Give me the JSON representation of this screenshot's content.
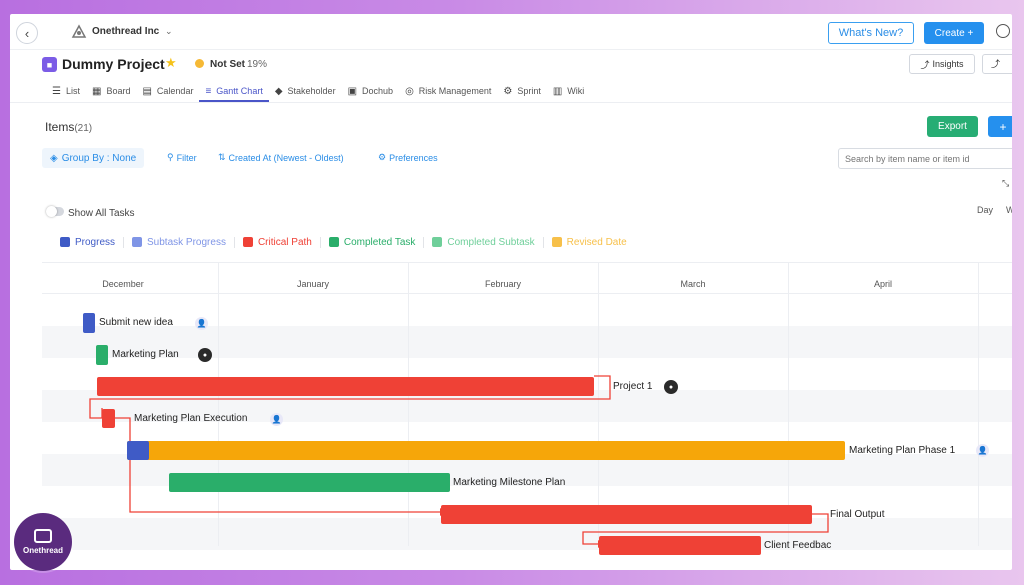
{
  "topbar": {
    "org_name": "Onethread Inc",
    "whats_new": "What's New?",
    "create": "Create +"
  },
  "project": {
    "title": "Dummy Project",
    "status": "Not Set",
    "progress": "19%",
    "insights": "Insights"
  },
  "tabs": [
    {
      "label": "List",
      "icon": "list-icon"
    },
    {
      "label": "Board",
      "icon": "board-icon"
    },
    {
      "label": "Calendar",
      "icon": "calendar-icon"
    },
    {
      "label": "Gantt Chart",
      "icon": "gantt-icon",
      "active": true
    },
    {
      "label": "Stakeholder",
      "icon": "stakeholder-icon"
    },
    {
      "label": "Dochub",
      "icon": "dochub-icon"
    },
    {
      "label": "Risk Management",
      "icon": "risk-icon"
    },
    {
      "label": "Sprint",
      "icon": "sprint-icon"
    },
    {
      "label": "Wiki",
      "icon": "wiki-icon"
    }
  ],
  "items": {
    "label": "Items",
    "count": "(21)",
    "export": "Export",
    "add": "+"
  },
  "toolbar": {
    "group_by": "Group By : None",
    "filter": "Filter",
    "sort": "Created At (Newest - Oldest)",
    "preferences": "Preferences",
    "search_placeholder": "Search by item name or item id"
  },
  "view": {
    "show_all": "Show All Tasks",
    "day": "Day",
    "week": "W"
  },
  "legend": [
    {
      "label": "Progress",
      "color": "#3f5bc6",
      "text_color": "#3f5bc6"
    },
    {
      "label": "Subtask Progress",
      "color": "#7f95e6",
      "text_color": "#7f95e6"
    },
    {
      "label": "Critical Path",
      "color": "#ef4136",
      "text_color": "#ef4136"
    },
    {
      "label": "Completed Task",
      "color": "#2aae6a",
      "text_color": "#2aae6a"
    },
    {
      "label": "Completed Subtask",
      "color": "#6fcf9a",
      "text_color": "#6fcf9a"
    },
    {
      "label": "Revised Date",
      "color": "#f7c04a",
      "text_color": "#f7c04a"
    }
  ],
  "months": [
    "December",
    "January",
    "February",
    "March",
    "April"
  ],
  "tasks": [
    {
      "name": "Submit new idea",
      "color": "#3f5bc6"
    },
    {
      "name": "Marketing Plan",
      "color": "#2aae6a"
    },
    {
      "name": "Project 1",
      "color": "#ef4136"
    },
    {
      "name": "Marketing Plan Execution",
      "color": "#ef4136"
    },
    {
      "name": "Marketing Plan Phase 1",
      "color": "#f6a609",
      "progress_color": "#3f5bc6"
    },
    {
      "name": "Marketing Milestone Plan",
      "color": "#2aae6a"
    },
    {
      "name": "Final Output",
      "color": "#ef4136"
    },
    {
      "name": "Client Feedbac",
      "color": "#ef4136"
    }
  ],
  "brand": {
    "name": "Onethread"
  }
}
